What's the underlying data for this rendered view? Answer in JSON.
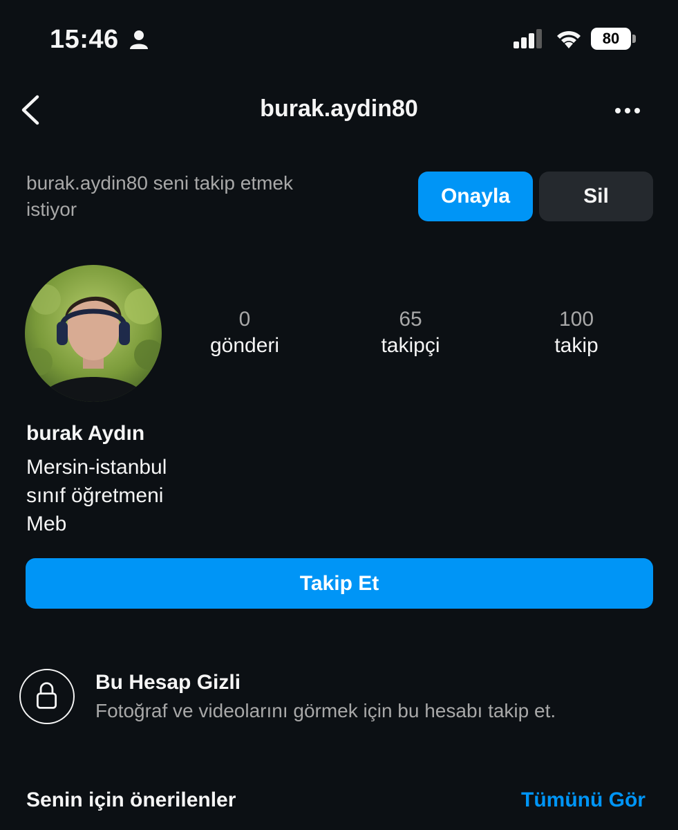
{
  "status_bar": {
    "time": "15:46",
    "battery": "80"
  },
  "header": {
    "title": "burak.aydin80"
  },
  "follow_request": {
    "text": "burak.aydin80 seni takip etmek istiyor",
    "confirm_label": "Onayla",
    "delete_label": "Sil"
  },
  "profile": {
    "stats": [
      {
        "value": "0",
        "label": "gönderi"
      },
      {
        "value": "65",
        "label": "takipçi"
      },
      {
        "value": "100",
        "label": "takip"
      }
    ],
    "name": "burak Aydın",
    "bio": [
      "Mersin-istanbul",
      "sınıf öğretmeni",
      "Meb"
    ],
    "follow_label": "Takip Et"
  },
  "private_notice": {
    "title": "Bu Hesap Gizli",
    "description": "Fotoğraf ve videolarını görmek için bu hesabı takip et."
  },
  "suggestions": {
    "title": "Senin için önerilenler",
    "see_all_label": "Tümünü Gör"
  },
  "colors": {
    "background": "#0c1014",
    "accent": "#0095f6",
    "secondary_button": "#25292e",
    "muted_text": "#a8a8a8"
  },
  "icons": [
    "person-icon",
    "signal-icon",
    "wifi-icon",
    "battery-icon",
    "back-chevron-icon",
    "more-icon",
    "lock-icon"
  ]
}
